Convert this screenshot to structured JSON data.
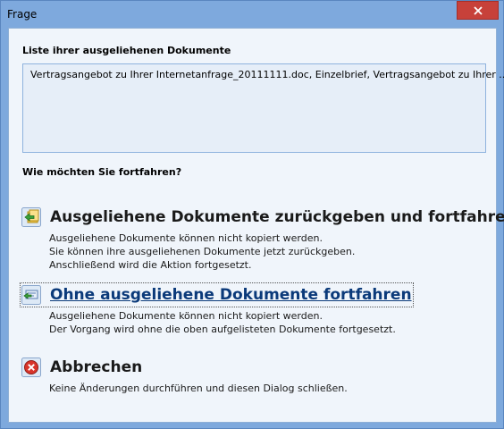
{
  "window": {
    "title": "Frage"
  },
  "documents": {
    "label": "Liste ihrer ausgeliehenen Dokumente",
    "items": [
      "Vertragsangebot zu Ihrer Internetanfrage_20111111.doc, Einzelbrief, Vertragsangebot zu Ihrer ..."
    ]
  },
  "question": "Wie möchten Sie fortfahren?",
  "options": [
    {
      "title": "Ausgeliehene Dokumente zurückgeben und fortfahren",
      "lines": [
        "Ausgeliehene Dokumente können nicht kopiert werden.",
        "Sie können ihre ausgeliehenen Dokumente jetzt zurückgeben.",
        "Anschließend wird die Aktion fortgesetzt."
      ]
    },
    {
      "title": "Ohne ausgeliehene Dokumente fortfahren",
      "lines": [
        "Ausgeliehene Dokumente können nicht kopiert werden.",
        "Der Vorgang wird ohne die oben aufgelisteten Dokumente fortgesetzt."
      ]
    },
    {
      "title": "Abbrechen",
      "lines": [
        "Keine Änderungen durchführen und diesen Dialog schließen."
      ]
    }
  ],
  "colors": {
    "close_button": "#c7413a",
    "link_text": "#0b3a7a",
    "cancel_icon": "#d8342a"
  },
  "icons": {
    "close": "close-icon",
    "document": "word-document-icon",
    "return": "return-documents-icon",
    "continue": "continue-icon",
    "cancel": "cancel-icon"
  }
}
